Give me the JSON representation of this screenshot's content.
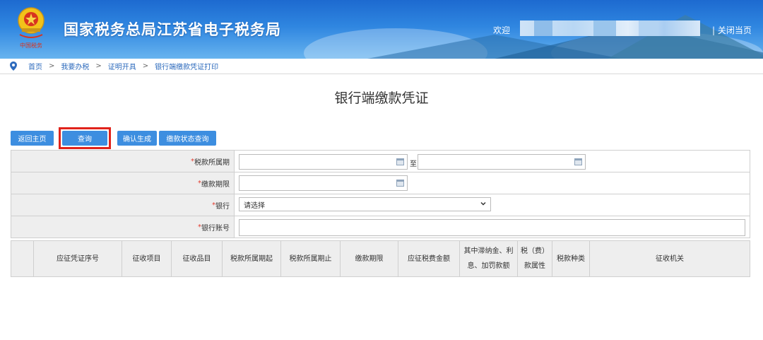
{
  "header": {
    "site_title": "国家税务总局江苏省电子税务局",
    "emblem_caption": "中国税务",
    "welcome": "欢迎",
    "close_page": "| 关闭当页"
  },
  "breadcrumb": {
    "items": [
      "首页",
      "我要办税",
      "证明开具",
      "银行端缴款凭证打印"
    ],
    "separator": ">"
  },
  "page_title": "银行端缴款凭证",
  "toolbar": {
    "home": "返回主页",
    "query": "查询",
    "confirm": "确认生成",
    "status_query": "缴款状态查询"
  },
  "form": {
    "required_mark": "*",
    "tax_period_label": "税款所属期",
    "to_label": "至",
    "due_date_label": "缴款期限",
    "bank_label": "银行",
    "bank_selected": "请选择",
    "account_label": "银行账号"
  },
  "table": {
    "columns": [
      [
        "应征凭证序号"
      ],
      [
        "征收项目"
      ],
      [
        "征收品目"
      ],
      [
        "税款所属期起"
      ],
      [
        "税款所属期止"
      ],
      [
        "缴款期限"
      ],
      [
        "应征税费金额"
      ],
      [
        "其中滞纳金、利",
        "息、加罚款额"
      ],
      [
        "税（费）",
        "款属性"
      ],
      [
        "税款种类"
      ],
      [
        "征收机关"
      ]
    ]
  },
  "colors": {
    "button_blue": "#3d8ee0",
    "highlight_red": "#e0231b",
    "link_blue": "#2e6bbd",
    "required_red": "#e23b2e"
  }
}
